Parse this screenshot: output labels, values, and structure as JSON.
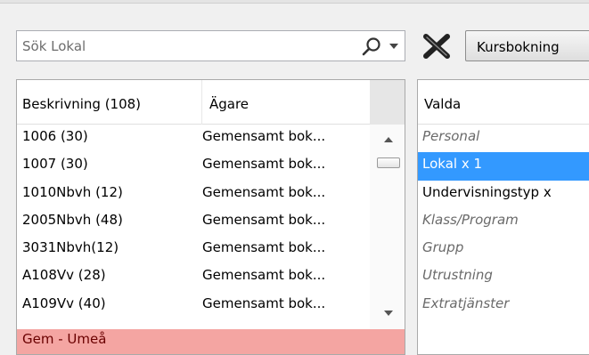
{
  "search": {
    "placeholder": "Sök Lokal"
  },
  "booking_type": {
    "selected": "Kursbokning"
  },
  "list": {
    "columns": [
      "Beskrivning (108)",
      "Ägare"
    ],
    "rows": [
      {
        "desc": "1006 (30)",
        "owner": "Gemensamt bok..."
      },
      {
        "desc": "1007 (30)",
        "owner": "Gemensamt bok..."
      },
      {
        "desc": "1010Nbvh (12)",
        "owner": "Gemensamt bok..."
      },
      {
        "desc": "2005Nbvh (48)",
        "owner": "Gemensamt bok..."
      },
      {
        "desc": "3031Nbvh(12)",
        "owner": "Gemensamt bok..."
      },
      {
        "desc": "A108Vv (28)",
        "owner": "Gemensamt bok..."
      },
      {
        "desc": "A109Vv (40)",
        "owner": "Gemensamt bok..."
      }
    ],
    "group_label": "Gem - Umeå"
  },
  "selected_panel": {
    "header": "Valda",
    "items": [
      {
        "label": "Personal",
        "state": "inactive"
      },
      {
        "label": "Lokal x 1",
        "state": "selected"
      },
      {
        "label": "Undervisningstyp x",
        "state": "active"
      },
      {
        "label": "Klass/Program",
        "state": "inactive"
      },
      {
        "label": "Grupp",
        "state": "inactive"
      },
      {
        "label": "Utrustning",
        "state": "inactive"
      },
      {
        "label": "Extratjänster",
        "state": "inactive"
      }
    ]
  },
  "colors": {
    "selection": "#3399ff",
    "group_row": "#f4a5a2",
    "inactive_text": "#6a6a6a"
  },
  "icons": [
    "search-icon",
    "chevron-down-icon",
    "close-icon",
    "chevron-up-icon"
  ]
}
